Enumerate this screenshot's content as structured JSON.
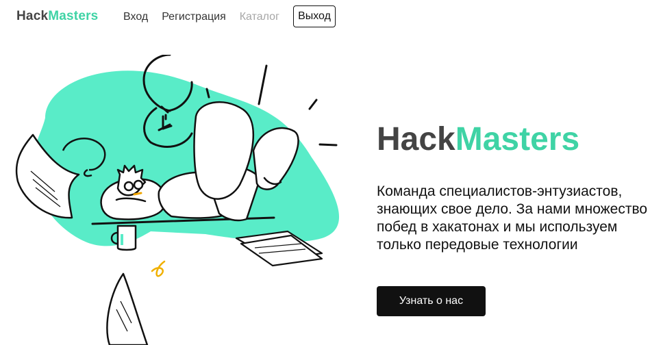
{
  "header": {
    "logo_part1": "Hack",
    "logo_part2": "Masters",
    "nav": {
      "login": "Вход",
      "register": "Регистрация",
      "catalog": "Каталог"
    },
    "logout_label": "Выход"
  },
  "hero": {
    "title_part1": "Hack",
    "title_part2": "Masters",
    "description": "Команда специалистов-энтузиастов, знающих свое дело. За нами множество побед в хакатонах и мы используем только передовые технологии",
    "cta_label": "Узнать о нас"
  },
  "colors": {
    "accent": "#3fd3a5",
    "text_dark": "#444444",
    "button_bg": "#111111",
    "nav_disabled": "#a6a6a6"
  }
}
